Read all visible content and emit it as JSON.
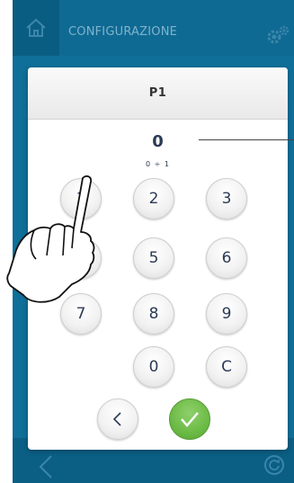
{
  "header": {
    "title": "CONFIGURAZIONE",
    "home_icon": "home-icon",
    "settings_icon": "gears-icon"
  },
  "footer": {
    "back_icon": "chevron-left-icon",
    "refresh_icon": "refresh-icon"
  },
  "dialog": {
    "title": "P1",
    "value": "0",
    "range": "0 ÷ 1"
  },
  "keypad": {
    "keys": [
      "1",
      "2",
      "3",
      "4",
      "5",
      "6",
      "7",
      "8",
      "9",
      "0",
      "C"
    ],
    "back_icon": "chevron-left-icon",
    "confirm_icon": "checkmark-icon",
    "confirm_color": "#6cbb46"
  },
  "overlay": {
    "pointer_icon": "pointing-hand-icon"
  },
  "colors": {
    "app_background": "#0f6f98",
    "text": "#2b3a55"
  }
}
